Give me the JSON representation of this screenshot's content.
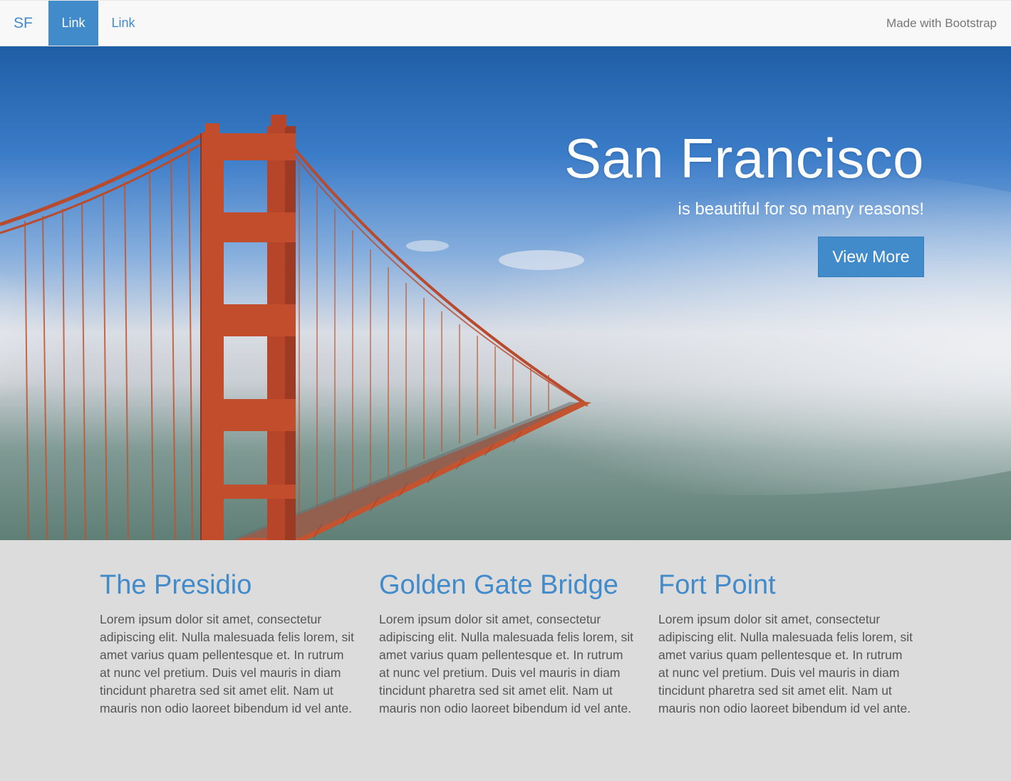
{
  "navbar": {
    "brand": "SF",
    "links": [
      "Link",
      "Link"
    ],
    "right_text": "Made with Bootstrap"
  },
  "hero": {
    "title": "San Francisco",
    "subtitle": "is beautiful for so many reasons!",
    "button_label": "View More"
  },
  "columns": [
    {
      "heading": "The Presidio",
      "body": "Lorem ipsum dolor sit amet, consectetur adipiscing elit. Nulla malesuada felis lorem, sit amet varius quam pellentesque et. In rutrum at nunc vel pretium. Duis vel mauris in diam tincidunt pharetra sed sit amet elit. Nam ut mauris non odio laoreet bibendum id vel ante."
    },
    {
      "heading": "Golden Gate Bridge",
      "body": "Lorem ipsum dolor sit amet, consectetur adipiscing elit. Nulla malesuada felis lorem, sit amet varius quam pellentesque et. In rutrum at nunc vel pretium. Duis vel mauris in diam tincidunt pharetra sed sit amet elit. Nam ut mauris non odio laoreet bibendum id vel ante."
    },
    {
      "heading": "Fort Point",
      "body": "Lorem ipsum dolor sit amet, consectetur adipiscing elit. Nulla malesuada felis lorem, sit amet varius quam pellentesque et. In rutrum at nunc vel pretium. Duis vel mauris in diam tincidunt pharetra sed sit amet elit. Nam ut mauris non odio laoreet bibendum id vel ante."
    }
  ],
  "colors": {
    "accent": "#428bca",
    "navbar_bg": "#f8f8f8",
    "content_bg": "#dcdcdc",
    "bridge": "#c0492b"
  }
}
